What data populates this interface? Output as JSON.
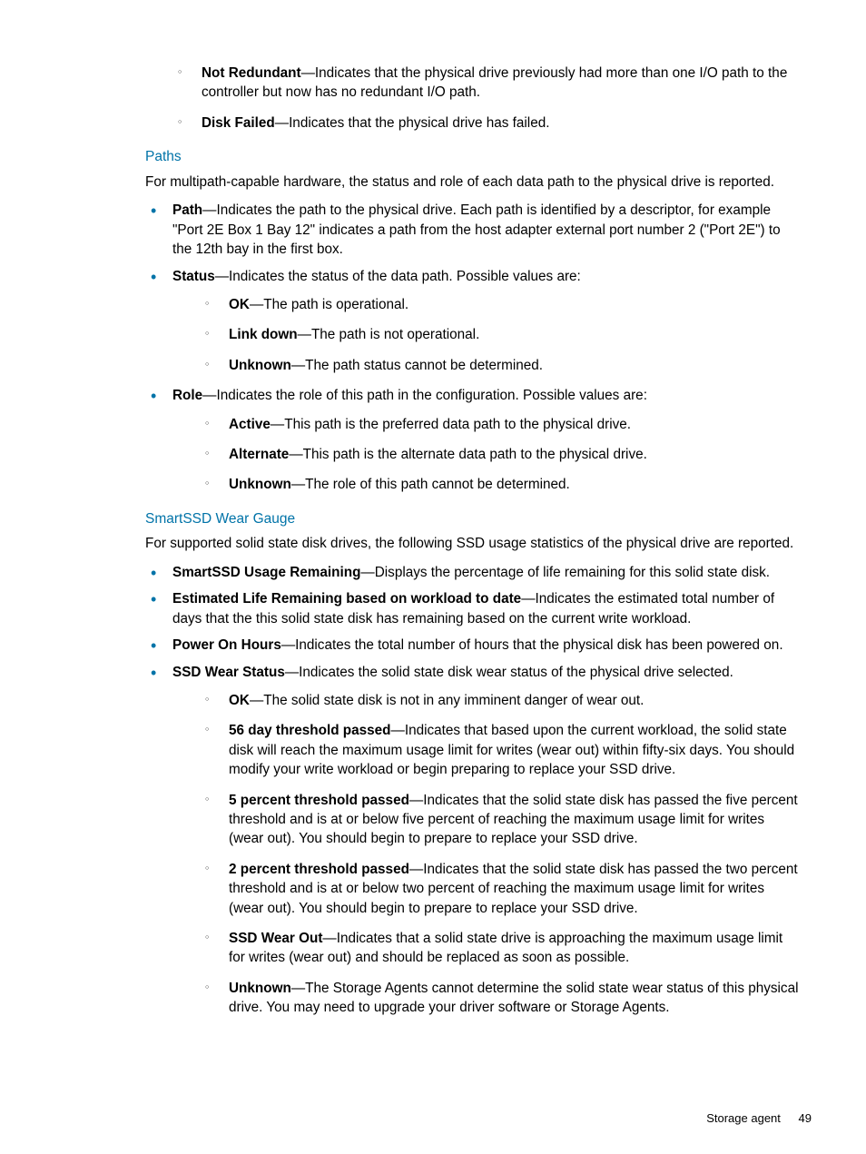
{
  "top_sublist": [
    {
      "term": "Not Redundant",
      "desc": "—Indicates that the physical drive previously had more than one I/O path to the controller but now has no redundant I/O path."
    },
    {
      "term": "Disk Failed",
      "desc": "—Indicates that the physical drive has failed."
    }
  ],
  "paths": {
    "heading": "Paths",
    "intro": "For multipath-capable hardware, the status and role of each data path to the physical drive is reported.",
    "items": [
      {
        "term": "Path",
        "desc": "—Indicates the path to the physical drive. Each path is identified by a descriptor, for example \"Port 2E Box 1 Bay 12\" indicates a path from the host adapter external port number 2 (\"Port 2E\") to the 12th bay in the first box."
      },
      {
        "term": "Status",
        "desc": "—Indicates the status of the data path. Possible values are:",
        "sub": [
          {
            "term": "OK",
            "desc": "—The path is operational."
          },
          {
            "term": "Link down",
            "desc": "—The path is not operational."
          },
          {
            "term": "Unknown",
            "desc": "—The path status cannot be determined."
          }
        ]
      },
      {
        "term": "Role",
        "desc": "—Indicates the role of this path in the configuration. Possible values are:",
        "sub": [
          {
            "term": "Active",
            "desc": "—This path is the preferred data path to the physical drive."
          },
          {
            "term": "Alternate",
            "desc": "—This path is the alternate data path to the physical drive."
          },
          {
            "term": "Unknown",
            "desc": "—The role of this path cannot be determined."
          }
        ]
      }
    ]
  },
  "smartssd": {
    "heading": "SmartSSD Wear Gauge",
    "intro": "For supported solid state disk drives, the following SSD usage statistics of the physical drive are reported.",
    "items": [
      {
        "term": "SmartSSD Usage Remaining",
        "desc": "—Displays the percentage of life remaining for this solid state disk."
      },
      {
        "term": "Estimated Life Remaining based on workload to date",
        "desc": "—Indicates the estimated total number of days that the this solid state disk has remaining based on the current write workload."
      },
      {
        "term": "Power On Hours",
        "desc": "—Indicates the total number of hours that the physical disk has been powered on."
      },
      {
        "term": "SSD Wear Status",
        "desc": "—Indicates the solid state disk wear status of the physical drive selected.",
        "sub": [
          {
            "term": "OK",
            "desc": "—The solid state disk is not in any imminent danger of wear out."
          },
          {
            "term": "56 day threshold passed",
            "desc": "—Indicates that based upon the current workload, the solid state disk will reach the maximum usage limit for writes (wear out) within fifty-six days. You should modify your write workload or begin preparing to replace your SSD drive."
          },
          {
            "term": "5 percent threshold passed",
            "desc": "—Indicates that the solid state disk has passed the five percent threshold and is at or below five percent of reaching the maximum usage limit for writes (wear out). You should begin to prepare to replace your SSD drive."
          },
          {
            "term": "2 percent threshold passed",
            "desc": "—Indicates that the solid state disk has passed the two percent threshold and is at or below two percent of reaching the maximum usage limit for writes (wear out). You should begin to prepare to replace your SSD drive."
          },
          {
            "term": "SSD Wear Out",
            "desc": "—Indicates that a solid state drive is approaching the maximum usage limit for writes (wear out) and should be replaced as soon as possible."
          },
          {
            "term": "Unknown",
            "desc": "—The Storage Agents cannot determine the solid state wear status of this physical drive. You may need to upgrade your driver software or Storage Agents."
          }
        ]
      }
    ]
  },
  "footer": {
    "label": "Storage agent",
    "page": "49"
  }
}
